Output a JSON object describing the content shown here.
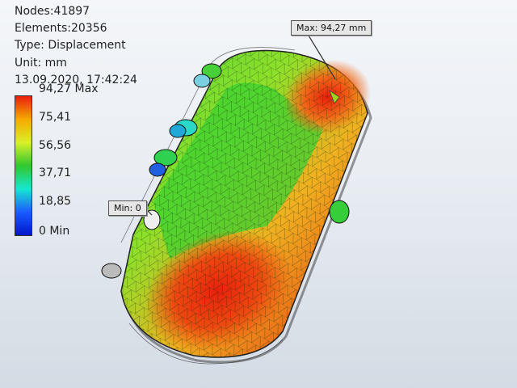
{
  "info": {
    "nodes": "Nodes:41897",
    "elements": "Elements:20356",
    "type": "Type: Displacement",
    "unit": "Unit: mm",
    "timestamp": "13.09.2020, 17:42:24"
  },
  "legend": {
    "labels": [
      "94,27 Max",
      "75,41",
      "56,56",
      "37,71",
      "18,85",
      "0 Min"
    ],
    "colors": [
      "#e8200c",
      "#f7a800",
      "#d9f02a",
      "#2ec82c",
      "#18e6d0",
      "#1a5dff",
      "#0016c8"
    ]
  },
  "callouts": {
    "max": "Max: 94,27 mm",
    "min": "Min: 0"
  }
}
